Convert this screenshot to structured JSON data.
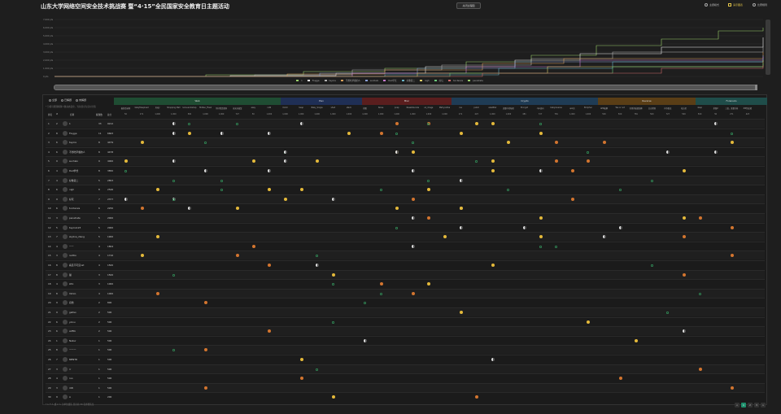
{
  "header": {
    "title": "山东大学网络空间安全技术挑战赛 暨“4·15”全民国家安全教育日主题活动",
    "center_button": "关闭过程图",
    "right_buttons": [
      {
        "label": "主题模式",
        "active": false
      },
      {
        "label": "演示图表",
        "active": true
      },
      {
        "label": "比赛规则",
        "active": false
      }
    ]
  },
  "chart": {
    "y_ticks": [
      "7,000 pts",
      "6,000 pts",
      "5,000 pts",
      "4,000 pts",
      "3,000 pts",
      "2,000 pts",
      "1,000 pts",
      "0 pts"
    ],
    "series_colors": [
      "#9ad06a",
      "#f0f0f0",
      "#b0b0b0",
      "#d9a05a",
      "#8aa0d8",
      "#c87bd1",
      "#6ab4c8",
      "#e0d06a",
      "#6ac87a",
      "#d06a6a"
    ],
    "legend": [
      "1",
      "Flugga",
      "tayore",
      "不想吃早餐的人",
      "sunhalo",
      "Dad学长",
      "好像第二",
      "nigh",
      "好玩",
      "tul.iterais",
      "penetrate"
    ]
  },
  "filters": {
    "items": [
      "全部",
      "已解题",
      "未解题"
    ],
    "note": "* 分值可能随解题人数动态变化，当前显示为实时分值"
  },
  "categories": [
    {
      "name": "Web",
      "color": "#1f4d33"
    },
    {
      "name": "Pwn",
      "color": "#1f2f55"
    },
    {
      "name": "Misc",
      "color": "#5a1e1e"
    },
    {
      "name": "Crypto",
      "color": "#1f3c55"
    },
    {
      "name": "Reverse",
      "color": "#5a3e16"
    },
    {
      "name": "Forensics",
      "color": "#1f4d4a"
    }
  ],
  "columns": {
    "rank": "排名",
    "id": "#",
    "name": "名称",
    "solved": "解题数",
    "score": "总分"
  },
  "challenges": [
    "极简登录框",
    "babyfileupload",
    "jiggy",
    "Shopping Mall",
    "lucia.workshop",
    "Hidden_Flask",
    "你好我是漏洞",
    "来来来抽奖",
    "easy",
    "ret2",
    "mmm",
    "heap",
    "Baby_Single",
    "shell",
    "stack",
    "拼图",
    "Noise",
    "pcap",
    "Nessbdecode",
    "ez_image",
    "Matryoshka",
    "rsa",
    "pubm",
    "ezezRSA",
    "流量中的秘密",
    "Encrypt",
    "cpp逆向",
    "babyreverse",
    "upx壳",
    "Ezcipher",
    "APK破解",
    "Tea or not",
    "奇怪的磁盘镜像",
    "日志溯源",
    "内存取证",
    "攻击者",
    "deep",
    "拼图2",
    "三篇，流量分析",
    "ZIP伪加密"
  ],
  "scores": [
    "50",
    "271",
    "1,000",
    "1,000",
    "500",
    "1,000",
    "1,000",
    "727",
    "50",
    "1,000",
    "1,000",
    "1,000",
    "1,000",
    "1,000",
    "1,000",
    "1,000",
    "1,000",
    "1,000",
    "1,000",
    "1,000",
    "1,000",
    "271",
    "423",
    "1,000",
    "1,000",
    "481",
    "727",
    "781",
    "1,000",
    "1,000",
    "500",
    "500",
    "781",
    "500",
    "727",
    "500",
    "500",
    "50",
    "271",
    "423"
  ],
  "rows": [
    {
      "rank": "1",
      "id": "2",
      "name": "1",
      "solved": "33",
      "score": "9212"
    },
    {
      "rank": "2",
      "id": "8",
      "name": "Flugga",
      "solved": "11",
      "score": "6663"
    },
    {
      "rank": "3",
      "id": "6",
      "name": "tayore",
      "solved": "8",
      "score": "4479"
    },
    {
      "rank": "4",
      "id": "6",
      "name": "不想吃早餐的人",
      "solved": "8",
      "score": "4478"
    },
    {
      "rank": "5",
      "id": "9",
      "name": "sunhalo",
      "solved": "9",
      "score": "4000"
    },
    {
      "rank": "6",
      "id": "4",
      "name": "Dad学长",
      "solved": "8",
      "score": "3850"
    },
    {
      "rank": "7",
      "id": "4",
      "name": "好像第二",
      "solved": "5",
      "score": "2853"
    },
    {
      "rank": "8",
      "id": "6",
      "name": "nigh",
      "solved": "8",
      "score": "2546"
    },
    {
      "rank": "9",
      "id": "9",
      "name": "好玩",
      "solved": "7",
      "score": "2377"
    },
    {
      "rank": "10",
      "id": "6",
      "name": "tul.iterais",
      "solved": "6",
      "score": "2250"
    },
    {
      "rank": "11",
      "id": "3",
      "name": "penetrate",
      "solved": "5",
      "score": "2000"
    },
    {
      "rank": "12",
      "id": "5",
      "name": "tayore123",
      "solved": "5",
      "score": "2000"
    },
    {
      "rank": "13",
      "id": "7",
      "name": "skyline_2lang",
      "solved": "5",
      "score": "1900"
    },
    {
      "rank": "14",
      "id": "4",
      "name": "一一",
      "solved": "4",
      "score": "1804"
    },
    {
      "rank": "15",
      "id": "3",
      "name": "redfox",
      "solved": "4",
      "score": "1716"
    },
    {
      "rank": "16",
      "id": "8",
      "name": "看见不可见cat",
      "solved": "4",
      "score": "1500"
    },
    {
      "rank": "17",
      "id": "8",
      "name": "猫",
      "solved": "3",
      "score": "1500"
    },
    {
      "rank": "18",
      "id": "4",
      "name": "LEA",
      "solved": "3",
      "score": "1000"
    },
    {
      "rank": "19",
      "id": "8",
      "name": "Yahiro",
      "solved": "4",
      "score": "1000"
    },
    {
      "rank": "20",
      "id": "9",
      "name": "初始",
      "solved": "2",
      "score": "800"
    },
    {
      "rank": "21",
      "id": "9",
      "name": "galfeo",
      "solved": "2",
      "score": "500"
    },
    {
      "rank": "22",
      "id": "6",
      "name": "yolvu",
      "solved": "2",
      "score": "500"
    },
    {
      "rank": "23",
      "id": "6",
      "name": "aVEIb",
      "solved": "2",
      "score": "500"
    },
    {
      "rank": "24",
      "id": "1",
      "name": "Nabur",
      "solved": "1",
      "score": "500"
    },
    {
      "rank": "25",
      "id": "8",
      "name": "一一一",
      "solved": "1",
      "score": "500"
    },
    {
      "rank": "26",
      "id": "7",
      "name": "MENTR",
      "solved": "1",
      "score": "500"
    },
    {
      "rank": "27",
      "id": "3",
      "name": "rr",
      "solved": "1",
      "score": "500"
    },
    {
      "rank": "28",
      "id": "4",
      "name": "ruo",
      "solved": "1",
      "score": "500"
    },
    {
      "rank": "29",
      "id": "3",
      "name": "ddh",
      "solved": "1",
      "score": "500"
    },
    {
      "rank": "30",
      "id": "9",
      "name": "A",
      "solved": "1",
      "score": "200"
    }
  ],
  "footer": {
    "note": "* 1 个人 或 2 人 为单位组队 显示前 30 名参赛队伍",
    "pages": [
      "<",
      "1",
      "2",
      "3",
      ">"
    ]
  }
}
